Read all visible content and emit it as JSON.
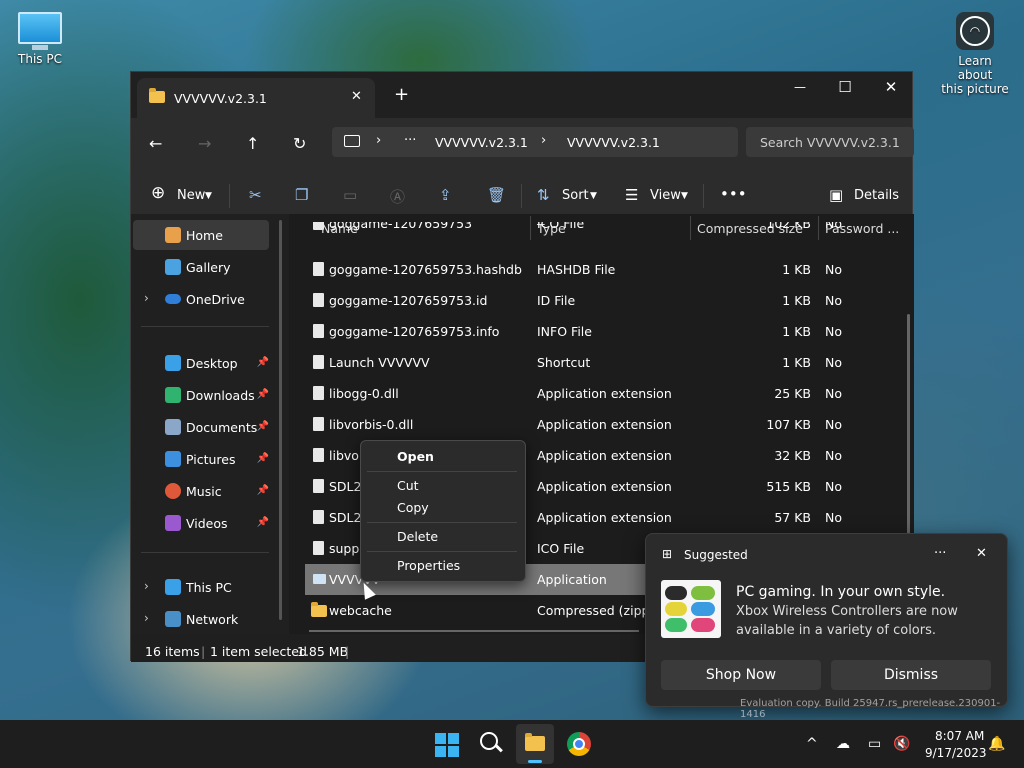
{
  "desktop": {
    "this_pc_label": "This PC",
    "learn_label_1": "Learn about",
    "learn_label_2": "this picture"
  },
  "window": {
    "tab_title": "VVVVVV.v2.3.1",
    "tab_close": "✕",
    "new_tab": "+",
    "minimize": "—",
    "maximize": "☐",
    "close": "✕"
  },
  "nav": {
    "back": "←",
    "forward": "→",
    "up": "↑",
    "refresh": "↻",
    "breadcrumb": [
      "VVVVVV.v2.3.1",
      "VVVVVV.v2.3.1"
    ],
    "more": "···",
    "search_placeholder": "Search VVVVVV.v2.3.1"
  },
  "toolbar": {
    "new_label": "New",
    "sort_label": "Sort",
    "view_label": "View",
    "more": "•••",
    "details_label": "Details"
  },
  "sidebar": {
    "items": [
      {
        "label": "Home"
      },
      {
        "label": "Gallery"
      },
      {
        "label": "OneDrive"
      },
      {
        "label": "Desktop"
      },
      {
        "label": "Downloads"
      },
      {
        "label": "Documents"
      },
      {
        "label": "Pictures"
      },
      {
        "label": "Music"
      },
      {
        "label": "Videos"
      },
      {
        "label": "This PC"
      },
      {
        "label": "Network"
      }
    ]
  },
  "columns": {
    "name": "Name",
    "type": "Type",
    "size": "Compressed size",
    "password": "Password ..."
  },
  "files": [
    {
      "name": "goggame-1207659753",
      "type": "ICO File",
      "size": "102 KB",
      "pw": "No"
    },
    {
      "name": "goggame-1207659753.hashdb",
      "type": "HASHDB File",
      "size": "1 KB",
      "pw": "No"
    },
    {
      "name": "goggame-1207659753.id",
      "type": "ID File",
      "size": "1 KB",
      "pw": "No"
    },
    {
      "name": "goggame-1207659753.info",
      "type": "INFO File",
      "size": "1 KB",
      "pw": "No"
    },
    {
      "name": "Launch VVVVVV",
      "type": "Shortcut",
      "size": "1 KB",
      "pw": "No"
    },
    {
      "name": "libogg-0.dll",
      "type": "Application extension",
      "size": "25 KB",
      "pw": "No"
    },
    {
      "name": "libvorbis-0.dll",
      "type": "Application extension",
      "size": "107 KB",
      "pw": "No"
    },
    {
      "name": "libvorbisfile-3.dll",
      "type": "Application extension",
      "size": "32 KB",
      "pw": "No"
    },
    {
      "name": "SDL2.dll",
      "type": "Application extension",
      "size": "515 KB",
      "pw": "No"
    },
    {
      "name": "SDL2_mixer.dll",
      "type": "Application extension",
      "size": "57 KB",
      "pw": "No"
    },
    {
      "name": "support",
      "type": "ICO File",
      "size": "",
      "pw": ""
    },
    {
      "name": "VVVVVV",
      "type": "Application",
      "size": "",
      "pw": ""
    },
    {
      "name": "webcache",
      "type": "Compressed (zipped)",
      "size": "",
      "pw": ""
    }
  ],
  "status": {
    "items": "16 items",
    "selected": "1 item selected",
    "size": "1.85 MB"
  },
  "context_menu": {
    "open": "Open",
    "cut": "Cut",
    "copy": "Copy",
    "delete": "Delete",
    "properties": "Properties"
  },
  "toast": {
    "header": "Suggested",
    "more": "···",
    "close": "✕",
    "title": "PC gaming. In your own style.",
    "body_1": "Xbox Wireless Controllers are now",
    "body_2": "available in a variety of colors.",
    "primary": "Shop Now",
    "secondary": "Dismiss"
  },
  "watermark": "Evaluation copy. Build 25947.rs_prerelease.230901-1416",
  "taskbar": {
    "time": "8:07 AM",
    "date": "9/17/2023",
    "tray_chevron": "^"
  },
  "colors": {
    "accent": "#4cc2ff",
    "selected_row": "#777777",
    "window_bg": "#1f1f1f"
  }
}
